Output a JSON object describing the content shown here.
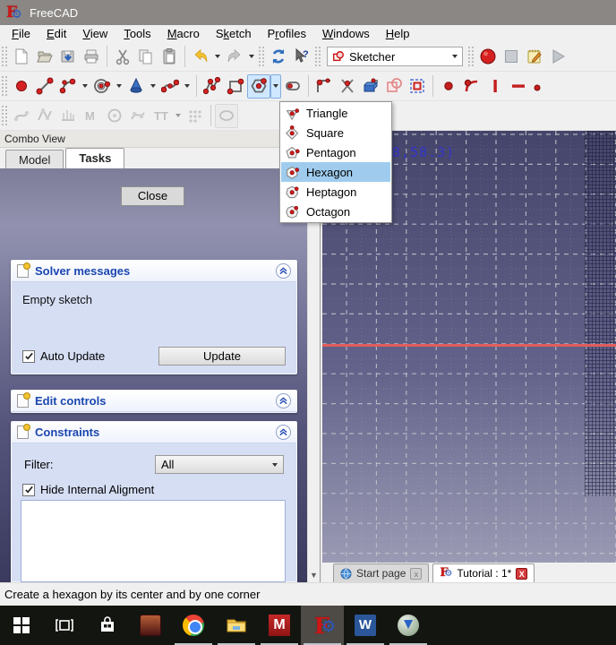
{
  "window": {
    "title": "FreeCAD"
  },
  "menu": {
    "items": [
      {
        "label": "File",
        "u": 0
      },
      {
        "label": "Edit",
        "u": 0
      },
      {
        "label": "View",
        "u": 0
      },
      {
        "label": "Tools",
        "u": 0
      },
      {
        "label": "Macro",
        "u": 0
      },
      {
        "label": "Sketch",
        "u": 1
      },
      {
        "label": "Profiles",
        "u": 1
      },
      {
        "label": "Windows",
        "u": 0
      },
      {
        "label": "Help",
        "u": 0
      }
    ]
  },
  "toolbar": {
    "workbench_selected": "Sketcher"
  },
  "polygon_menu": {
    "selected_index": 3,
    "items": [
      {
        "label": "Triangle",
        "sides": 3
      },
      {
        "label": "Square",
        "sides": 4
      },
      {
        "label": "Pentagon",
        "sides": 5
      },
      {
        "label": "Hexagon",
        "sides": 6
      },
      {
        "label": "Heptagon",
        "sides": 7
      },
      {
        "label": "Octagon",
        "sides": 8
      }
    ]
  },
  "combo_view": {
    "title": "Combo View",
    "tabs": [
      {
        "label": "Model"
      },
      {
        "label": "Tasks"
      }
    ],
    "active_tab": "Tasks",
    "close_button": "Close",
    "solver": {
      "title": "Solver messages",
      "message": "Empty sketch",
      "auto_update": {
        "label": "Auto Update",
        "checked": true
      },
      "update_button": "Update"
    },
    "edit_controls": {
      "title": "Edit controls"
    },
    "constraints": {
      "title": "Constraints",
      "filter_label": "Filter:",
      "filter_value": "All",
      "hide_internal": {
        "label": "Hide Internal Aligment",
        "checked": true
      },
      "list_items": []
    }
  },
  "viewport": {
    "coordinates_text": "8,58.3)"
  },
  "doc_tabs": [
    {
      "label": "Start page",
      "active": false
    },
    {
      "label": "Tutorial : 1*",
      "active": true
    }
  ],
  "status_bar": {
    "text": "Create a hexagon by its center and by one corner"
  },
  "colors": {
    "selection_highlight": "#9fccee",
    "axis_x": "#e25c5c",
    "coords_text": "#3333cc",
    "section_title": "#1a46b0",
    "viewport_top": "#45456b",
    "viewport_bottom": "#9a9ab4",
    "titlebar": "#8a8784"
  }
}
